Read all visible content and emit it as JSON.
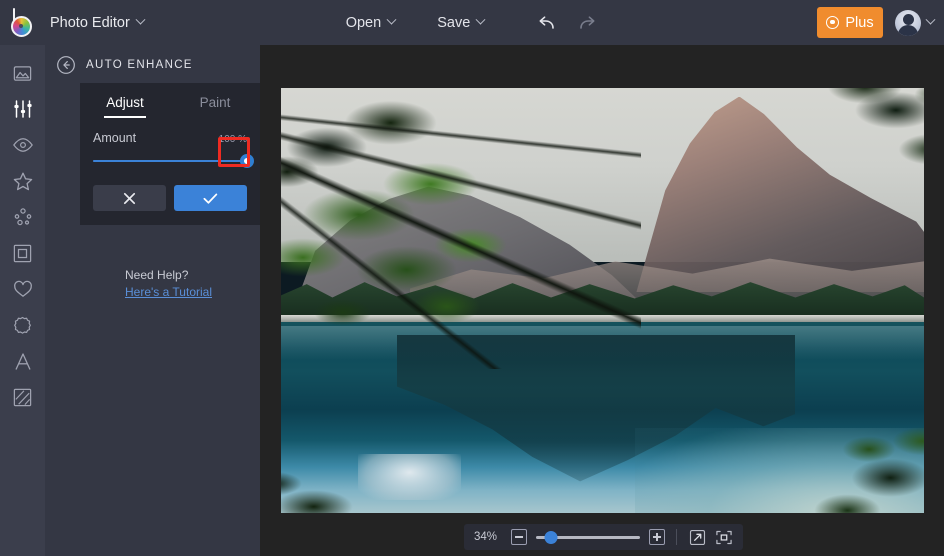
{
  "app": {
    "logo_icon": "befunky-b-colorwheel-logo",
    "title": "Photo Editor",
    "title_caret_icon": "chevron-down-icon"
  },
  "topbar": {
    "open_label": "Open",
    "open_caret_icon": "chevron-down-icon",
    "save_label": "Save",
    "save_caret_icon": "chevron-down-icon",
    "undo_icon": "undo-arrow-icon",
    "redo_icon": "redo-arrow-icon",
    "plus_label": "Plus",
    "plus_icon": "plus-badge-icon",
    "plus_color": "#f08c2e",
    "avatar_icon": "user-avatar",
    "avatar_caret_icon": "chevron-down-icon"
  },
  "sidebar": {
    "items": [
      {
        "name": "sidebar-item-image",
        "icon": "image-mountain-icon"
      },
      {
        "name": "sidebar-item-edit",
        "icon": "sliders-icon",
        "active": true
      },
      {
        "name": "sidebar-item-touchup",
        "icon": "eye-icon"
      },
      {
        "name": "sidebar-item-effects",
        "icon": "star-icon"
      },
      {
        "name": "sidebar-item-artsy",
        "icon": "particles-icon"
      },
      {
        "name": "sidebar-item-frames",
        "icon": "frame-icon"
      },
      {
        "name": "sidebar-item-overlays",
        "icon": "heart-icon"
      },
      {
        "name": "sidebar-item-graphics",
        "icon": "badge-icon"
      },
      {
        "name": "sidebar-item-text",
        "icon": "text-a-icon"
      },
      {
        "name": "sidebar-item-textures",
        "icon": "texture-icon"
      }
    ]
  },
  "panel": {
    "back_icon": "back-arrow-circle-icon",
    "title": "AUTO ENHANCE",
    "tabs": [
      {
        "label": "Adjust",
        "active": true
      },
      {
        "label": "Paint",
        "active": false
      }
    ],
    "slider": {
      "label": "Amount",
      "value_text": "100 %",
      "percent": 100
    },
    "cancel_icon": "close-x-icon",
    "apply_icon": "check-icon",
    "apply_color": "#3b82d8",
    "help_title": "Need Help?",
    "help_link": "Here's a Tutorial"
  },
  "annotation": {
    "color": "#ef2b22",
    "target": "amount-slider-knob"
  },
  "canvas": {
    "photo_alt": "mountain lake with pine branches and reflection"
  },
  "zoombar": {
    "zoom_level": "34%",
    "zoom_out_icon": "minus-icon",
    "zoom_in_icon": "plus-icon",
    "slider_percent": 14,
    "expand_icon": "expand-arrow-icon",
    "fit_icon": "fit-to-screen-icon"
  }
}
